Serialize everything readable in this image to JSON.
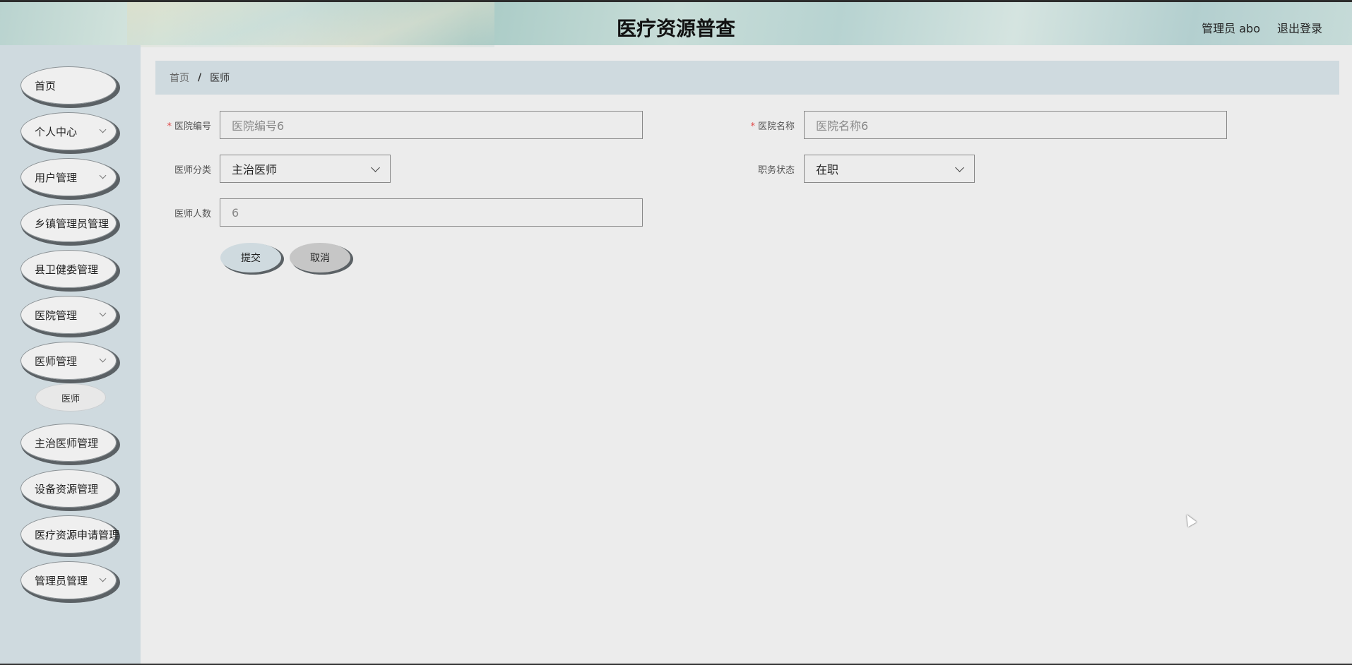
{
  "header": {
    "title": "医疗资源普查",
    "user_label": "管理员 abo",
    "logout_label": "退出登录"
  },
  "sidebar": {
    "items": [
      {
        "label": "首页",
        "has_children": false
      },
      {
        "label": "个人中心",
        "has_children": true
      },
      {
        "label": "用户管理",
        "has_children": true
      },
      {
        "label": "乡镇管理员管理",
        "has_children": false
      },
      {
        "label": "县卫健委管理",
        "has_children": false
      },
      {
        "label": "医院管理",
        "has_children": true
      },
      {
        "label": "医师管理",
        "has_children": true
      },
      {
        "label": "主治医师管理",
        "has_children": false
      },
      {
        "label": "设备资源管理",
        "has_children": false
      },
      {
        "label": "医疗资源申请管理",
        "has_children": false
      },
      {
        "label": "管理员管理",
        "has_children": true
      }
    ],
    "sub_items": [
      {
        "label": "医师"
      }
    ]
  },
  "breadcrumb": {
    "home": "首页",
    "separator": "/",
    "current": "医师"
  },
  "form": {
    "hospital_code": {
      "label": "医院编号",
      "required": true,
      "value": "医院编号6"
    },
    "hospital_name": {
      "label": "医院名称",
      "required": true,
      "value": "医院名称6"
    },
    "doctor_category": {
      "label": "医师分类",
      "value": "主治医师"
    },
    "job_status": {
      "label": "职务状态",
      "value": "在职"
    },
    "doctor_count": {
      "label": "医师人数",
      "value": "6"
    },
    "required_mark": "*",
    "submit_label": "提交",
    "cancel_label": "取消"
  },
  "colors": {
    "sidebar_bg": "#cfdadf",
    "main_bg": "#ececec",
    "required": "#e04a4a"
  }
}
